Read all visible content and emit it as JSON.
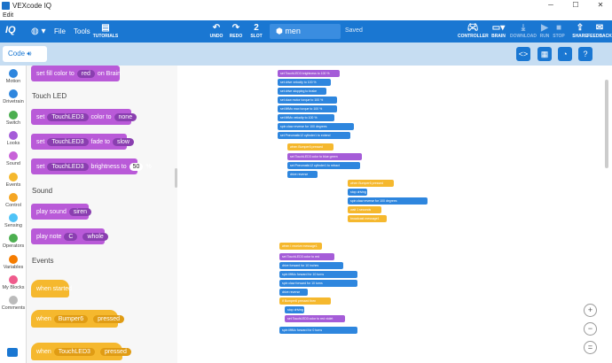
{
  "window": {
    "title": "VEXcode IQ",
    "min": "─",
    "max": "☐",
    "close": "✕"
  },
  "menubar": {
    "edit": "Edit"
  },
  "toolbar": {
    "logo": "IQ",
    "globe": "◍ ▾",
    "file": "File",
    "tools": "Tools",
    "tutorials": "TUTORIALS",
    "undo": "UNDO",
    "redo": "REDO",
    "slot_num": "2",
    "slot": "SLOT",
    "project_name": "men",
    "saved": "Saved",
    "controller": "CONTROLLER",
    "brain": "BRAIN",
    "download": "DOWNLOAD",
    "run": "RUN",
    "stop": "STOP",
    "share": "SHARE",
    "feedback": "FEEDBACK"
  },
  "tabbar": {
    "code_tab": "Code",
    "btn_code": "<>",
    "btn_devices": "▦",
    "btn_dash": "◔",
    "btn_help": "?"
  },
  "categories": [
    {
      "label": "Motion",
      "color": "#2e86de"
    },
    {
      "label": "Drivetrain",
      "color": "#2e86de"
    },
    {
      "label": "Switch",
      "color": "#4caf50"
    },
    {
      "label": "Looks",
      "color": "#a55cd8"
    },
    {
      "label": "Sound",
      "color": "#c862d8"
    },
    {
      "label": "Events",
      "color": "#f5b82e"
    },
    {
      "label": "Control",
      "color": "#f5a623"
    },
    {
      "label": "Sensing",
      "color": "#4fc3f7"
    },
    {
      "label": "Operators",
      "color": "#4caf50"
    },
    {
      "label": "Variables",
      "color": "#f57c00"
    },
    {
      "label": "My Blocks",
      "color": "#ef5b8c"
    },
    {
      "label": "Comments",
      "color": "#bbbbbb"
    }
  ],
  "palette": {
    "fill_block": {
      "pre": "set fill color to",
      "color": "red",
      "post": "on Brain"
    },
    "touchled_header": "Touch LED",
    "color_block": {
      "set": "set",
      "dev": "TouchLED3",
      "mid": "color to",
      "val": "none"
    },
    "fade_block": {
      "set": "set",
      "dev": "TouchLED3",
      "mid": "fade to",
      "val": "slow"
    },
    "bright_block": {
      "set": "set",
      "dev": "TouchLED3",
      "mid": "brightness to",
      "val": "50",
      "unit": "%"
    },
    "sound_header": "Sound",
    "play_sound": {
      "pre": "play sound",
      "val": "siren"
    },
    "play_note": {
      "pre": "play note",
      "note": "C",
      "dur": "whole"
    },
    "events_header": "Events",
    "when_started": "when started",
    "when_bumper": {
      "pre": "when",
      "dev": "Bumper6",
      "val": "pressed"
    },
    "when_touch": {
      "pre": "when",
      "dev": "TouchLED3",
      "val": "pressed"
    }
  },
  "canvas_blocks": [
    {
      "text": "set TouchLED3 brightness to 100 %",
      "c": "mp",
      "l": 313,
      "t": 79,
      "w": 70
    },
    {
      "text": "set drive velocity to 100 %",
      "c": "mb",
      "l": 313,
      "t": 89,
      "w": 60
    },
    {
      "text": "set drive stopping to brake",
      "c": "mb",
      "l": 313,
      "t": 99,
      "w": 55
    },
    {
      "text": "set claw motor torque to 100 %",
      "c": "mb",
      "l": 313,
      "t": 109,
      "w": 67
    },
    {
      "text": "set liftMo max torque to 100 %",
      "c": "mb",
      "l": 313,
      "t": 119,
      "w": 67
    },
    {
      "text": "set liftMo velocity to 100 %",
      "c": "mb",
      "l": 313,
      "t": 129,
      "w": 64
    },
    {
      "text": "spin claw reverse for 100 degrees",
      "c": "mb",
      "l": 313,
      "t": 139,
      "w": 86
    },
    {
      "text": "set Pneumatic12 cylinder1 to extend",
      "c": "mb",
      "l": 313,
      "t": 149,
      "w": 82
    },
    {
      "text": "when Bumper6 pressed",
      "c": "my",
      "l": 324,
      "t": 162,
      "w": 52
    },
    {
      "text": "set TouchLED3 color to blue green",
      "c": "mp",
      "l": 324,
      "t": 173,
      "w": 84
    },
    {
      "text": "set Pneumatic12 cylinder1 to retract",
      "c": "mb",
      "l": 324,
      "t": 183,
      "w": 82
    },
    {
      "text": "drive reverse",
      "c": "mb",
      "l": 324,
      "t": 193,
      "w": 34
    },
    {
      "text": "when Bumper6 pressed",
      "c": "my",
      "l": 392,
      "t": 203,
      "w": 52
    },
    {
      "text": "stop driving",
      "c": "mb",
      "l": 392,
      "t": 213,
      "w": 22
    },
    {
      "text": "spin claw reverse for 100 degrees",
      "c": "mb",
      "l": 392,
      "t": 223,
      "w": 90
    },
    {
      "text": "wait 1 seconds",
      "c": "my",
      "l": 392,
      "t": 233,
      "w": 38
    },
    {
      "text": "broadcast message1",
      "c": "my",
      "l": 392,
      "t": 243,
      "w": 44
    },
    {
      "text": "when I receive message1",
      "c": "my",
      "l": 315,
      "t": 274,
      "w": 48
    },
    {
      "text": "set TouchLED3 color to red",
      "c": "mp",
      "l": 315,
      "t": 286,
      "w": 62
    },
    {
      "text": "drive forward for 10 inches",
      "c": "mb",
      "l": 315,
      "t": 296,
      "w": 72
    },
    {
      "text": "spin liftMo forward for 10 turns",
      "c": "mb",
      "l": 315,
      "t": 306,
      "w": 88
    },
    {
      "text": "spin claw forward for 10 turns",
      "c": "mb",
      "l": 315,
      "t": 316,
      "w": 88
    },
    {
      "text": "drive reverse",
      "c": "mb",
      "l": 315,
      "t": 326,
      "w": 32
    },
    {
      "text": "if Bumper6 pressed then",
      "c": "my",
      "l": 315,
      "t": 336,
      "w": 58
    },
    {
      "text": "stop driving",
      "c": "mb",
      "l": 321,
      "t": 346,
      "w": 22
    },
    {
      "text": "set TouchLED3 color to red violet",
      "c": "mp",
      "l": 321,
      "t": 356,
      "w": 68
    },
    {
      "text": "spin liftMo forward for 0 turns",
      "c": "mb",
      "l": 315,
      "t": 369,
      "w": 88
    }
  ],
  "zoom": {
    "in": "+",
    "out": "−",
    "reset": "="
  }
}
